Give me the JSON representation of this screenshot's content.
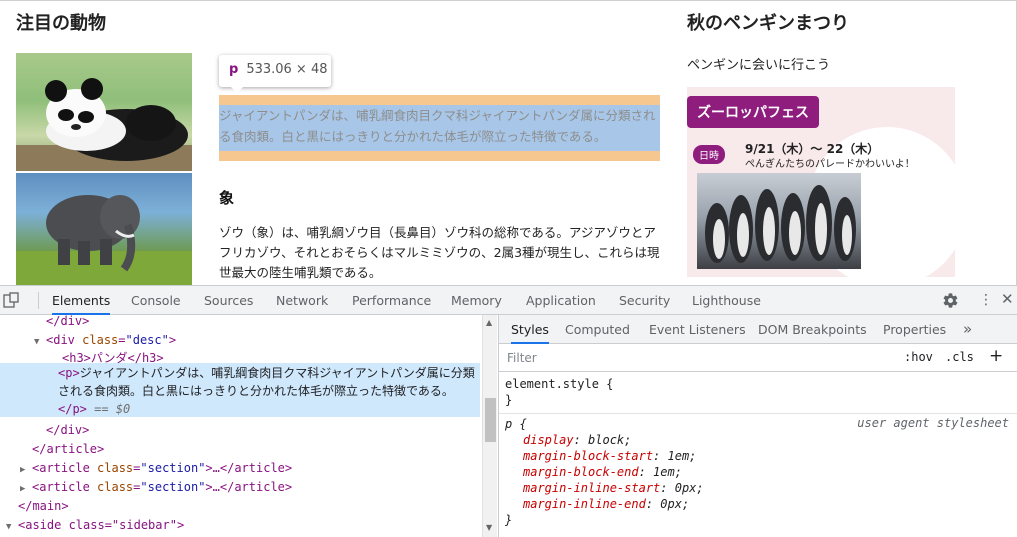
{
  "page": {
    "main_heading": "注目の動物",
    "sidebar_heading": "秋のペンギンまつり",
    "sidebar_sub": "ペンギンに会いに行こう",
    "tooltip": {
      "tag": "p",
      "dimensions": "533.06 × 48"
    },
    "panda_desc": "ジャイアントパンダは、哺乳綱食肉目クマ科ジャイアントパンダ属に分類される食肉類。白と黒にはっきりと分かれた体毛が際立った特徴である。",
    "elephant_heading": "象",
    "elephant_desc": "ゾウ（象）は、哺乳綱ゾウ目（長鼻目）ゾウ科の総称である。アジアゾウとアフリカゾウ、それとおそらくはマルミミゾウの、2属3種が現生し、これらは現世最大の陸生哺乳類である。",
    "festival": {
      "title": "ズーロッパフェス",
      "badge": "日時",
      "date": "9/21（木）～ 22（木）",
      "note": "ぺんぎんたちのパレードかわいいよ！"
    }
  },
  "devtools": {
    "tabs": [
      "Elements",
      "Console",
      "Sources",
      "Network",
      "Performance",
      "Memory",
      "Application",
      "Security",
      "Lighthouse"
    ],
    "active_tab": "Elements",
    "dom": {
      "line1": "</div>",
      "line2_tag_open": "<div",
      "line2_attr": "class",
      "line2_value": "\"desc\"",
      "line2_close": ">",
      "line3": "<h3>パンダ</h3>",
      "p_open": "<p>",
      "p_text": "ジャイアントパンダは、哺乳綱食肉目クマ科ジャイアントパンダ属に分類される食肉類。白と黒にはっきりと分かれた体毛が際立った特徴である。",
      "p_close": "</p>",
      "p_eq": "== $0",
      "line5": "</div>",
      "line6": "</article>",
      "article_open": "<article",
      "article_attr": "class",
      "article_value": "\"section\"",
      "article_rest": ">…</article>",
      "line9": "</main>",
      "line10": "<aside class=\"sidebar\">"
    },
    "style_tabs": [
      "Styles",
      "Computed",
      "Event Listeners",
      "DOM Breakpoints",
      "Properties"
    ],
    "active_style_tab": "Styles",
    "more_tabs": "»",
    "filter_placeholder": "Filter",
    "hov": ":hov",
    "cls": ".cls",
    "add": "+",
    "element_style": "element.style {",
    "close_brace": "}",
    "rule_selector": "p {",
    "rule_source": "user agent stylesheet",
    "rules": [
      {
        "prop": "display",
        "value": "block;"
      },
      {
        "prop": "margin-block-start",
        "value": "1em;"
      },
      {
        "prop": "margin-block-end",
        "value": "1em;"
      },
      {
        "prop": "margin-inline-start",
        "value": "0px;"
      },
      {
        "prop": "margin-inline-end",
        "value": "0px;"
      }
    ]
  }
}
